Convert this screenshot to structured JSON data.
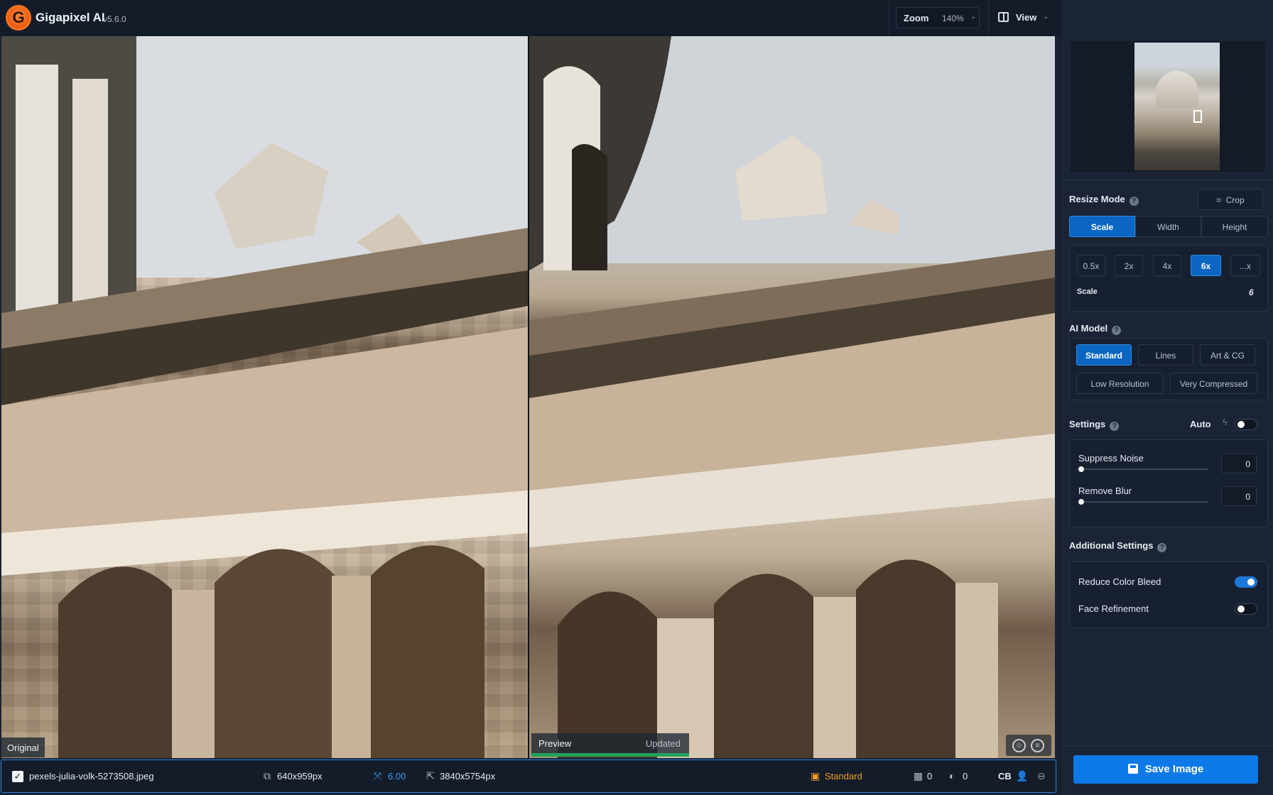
{
  "app": {
    "name": "Gigapixel AI",
    "version": "v5.6.0",
    "logo_letter": "G"
  },
  "toolbar": {
    "zoom_label": "Zoom",
    "zoom_value": "140%",
    "view_label": "View"
  },
  "panels": {
    "original_label": "Original",
    "preview_label": "Preview",
    "preview_status": "Updated"
  },
  "status": {
    "filename": "pexels-julia-volk-5273508.jpeg",
    "input_size": "640x959px",
    "scale": "6.00",
    "output_size": "3840x5754px",
    "model": "Standard",
    "count_a": "0",
    "count_b": "0",
    "cb": "CB"
  },
  "resize": {
    "title": "Resize Mode",
    "crop_label": "Crop",
    "modes": [
      "Scale",
      "Width",
      "Height"
    ],
    "active_mode": "Scale",
    "presets": [
      "0.5x",
      "2x",
      "4x",
      "6x",
      "...x"
    ],
    "active_preset": "6x",
    "scale_label": "Scale",
    "scale_value": "6"
  },
  "ai_model": {
    "title": "AI Model",
    "row1": [
      "Standard",
      "Lines",
      "Art & CG"
    ],
    "row2": [
      "Low Resolution",
      "Very Compressed"
    ],
    "active": "Standard"
  },
  "settings": {
    "title": "Settings",
    "auto_label": "Auto",
    "auto_enabled": false,
    "suppress_noise_label": "Suppress Noise",
    "suppress_noise_value": "0",
    "remove_blur_label": "Remove Blur",
    "remove_blur_value": "0"
  },
  "additional": {
    "title": "Additional Settings",
    "reduce_color_bleed_label": "Reduce Color Bleed",
    "reduce_color_bleed_enabled": true,
    "face_refinement_label": "Face Refinement",
    "face_refinement_enabled": false
  },
  "save": {
    "label": "Save Image"
  },
  "colors": {
    "accent": "#0a66c2",
    "save": "#0d79e8",
    "progress": "#1fa45a",
    "model_badge": "#f29d2c"
  }
}
